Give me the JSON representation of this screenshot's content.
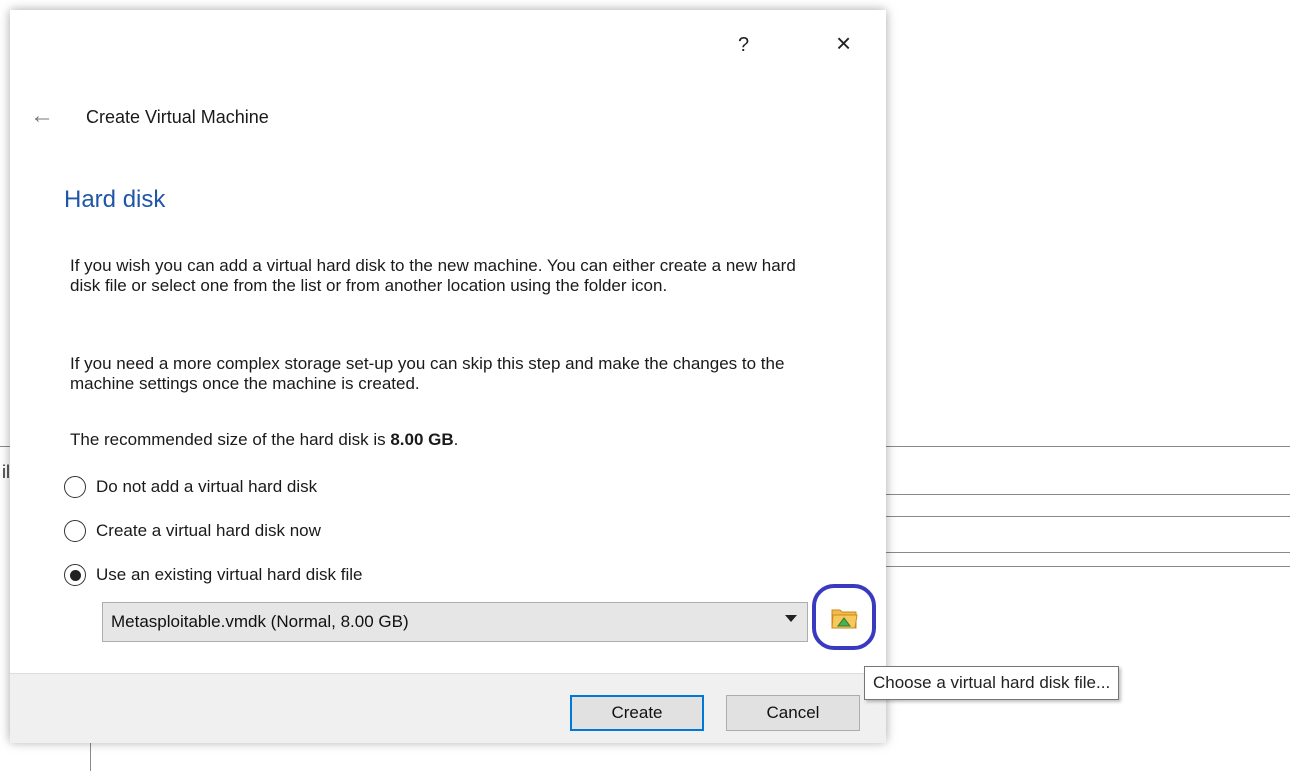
{
  "dialog": {
    "help_label": "?",
    "close_label": "×",
    "wizard_title": "Create Virtual Machine",
    "section_title": "Hard disk",
    "paragraph1": "If you wish you can add a virtual hard disk to the new machine. You can either create a new hard disk file or select one from the list or from another location using the folder icon.",
    "paragraph2": "If you need a more complex storage set-up you can skip this step and make the changes to the machine settings once the machine is created.",
    "recommended_prefix": "The recommended size of the hard disk is ",
    "recommended_size": "8.00 GB",
    "recommended_suffix": ".",
    "options": [
      {
        "label": "Do not add a virtual hard disk",
        "selected": false
      },
      {
        "label": "Create a virtual hard disk now",
        "selected": false
      },
      {
        "label": "Use an existing virtual hard disk file",
        "selected": true
      }
    ],
    "disk_selected": "Metasploitable.vmdk (Normal, 8.00 GB)",
    "folder_icon": "folder-icon",
    "tooltip": "Choose a virtual hard disk file...",
    "buttons": {
      "create": "Create",
      "cancel": "Cancel"
    }
  },
  "background": {
    "edge_char": "il"
  },
  "colors": {
    "accent": "#1f56a8",
    "focus": "#0078d7",
    "highlight_circle": "#3a3ac0"
  }
}
